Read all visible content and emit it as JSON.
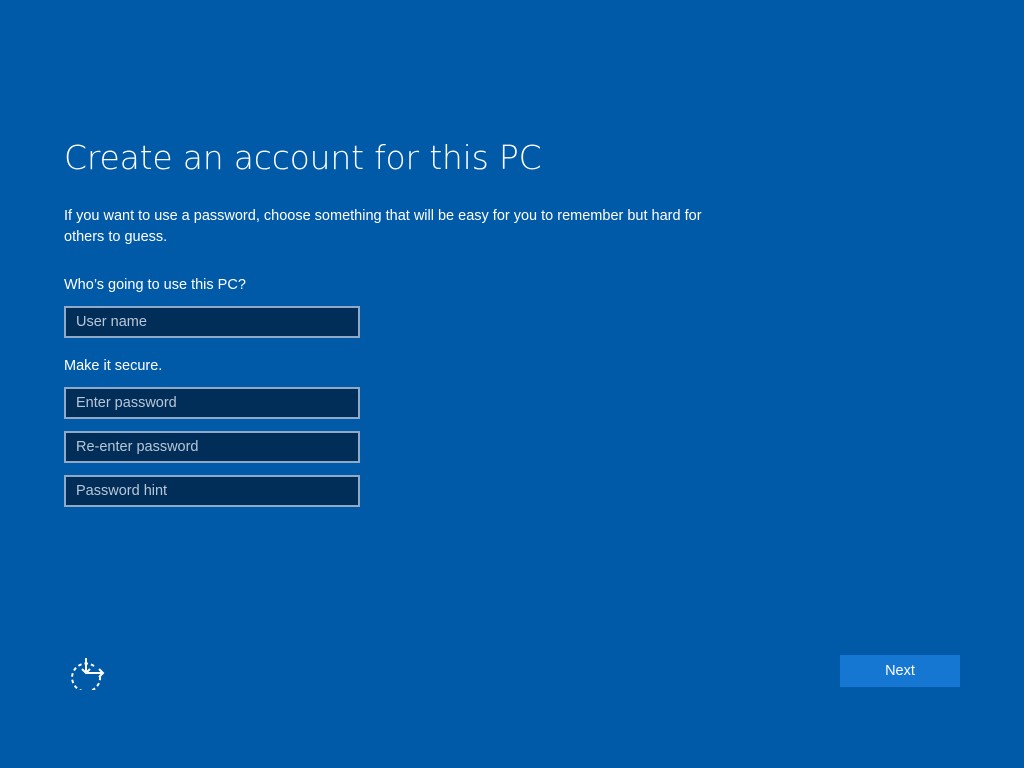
{
  "colors": {
    "background": "#005aa8",
    "field_background": "#012e59",
    "field_border": "#8fa9c6",
    "button_accent": "#1677d3",
    "text": "#ffffff"
  },
  "header": {
    "title": "Create an account for this PC"
  },
  "main": {
    "description": "If you want to use a password, choose something that will be easy for you to remember but hard for others to guess.",
    "question": "Who’s going to use this PC?",
    "secure_label": "Make it secure.",
    "fields": {
      "username": {
        "placeholder": "User name",
        "value": ""
      },
      "password": {
        "placeholder": "Enter password",
        "value": ""
      },
      "reenter": {
        "placeholder": "Re-enter password",
        "value": ""
      },
      "hint": {
        "placeholder": "Password hint",
        "value": ""
      }
    }
  },
  "footer": {
    "ease_of_access_icon": "ease-of-access-icon",
    "next_label": "Next"
  }
}
